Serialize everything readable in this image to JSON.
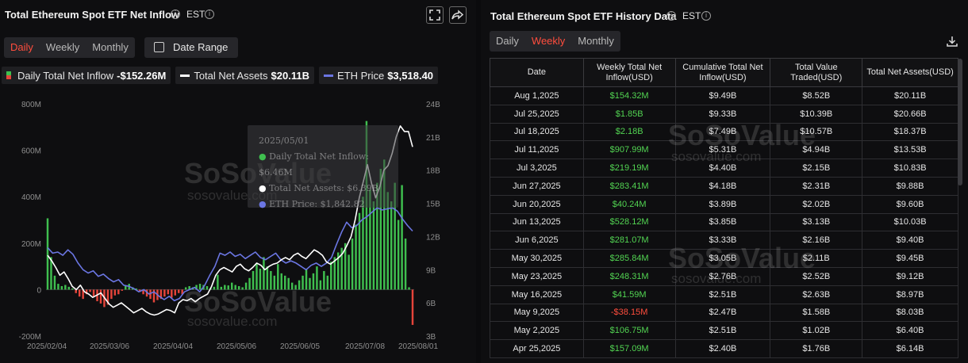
{
  "left": {
    "title": "Total Ethereum Spot ETF Net Inflow",
    "timezone": "EST",
    "tabs": [
      "Daily",
      "Weekly",
      "Monthly"
    ],
    "active_tab": "Daily",
    "date_range_label": "Date Range",
    "legend": {
      "inflow_label": "Daily Total Net Inflow",
      "inflow_value": "-$152.26M",
      "assets_label": "Total Net Assets",
      "assets_value": "$20.11B",
      "price_label": "ETH Price",
      "price_value": "$3,518.40"
    },
    "tooltip": {
      "date": "2025/05/01",
      "inflow": "Daily Total Net Inflow: $6.46M",
      "assets": "Total Net Assets: $6.39B",
      "price": "ETH Price: $1,842.82"
    },
    "watermark": {
      "brand": "SoSoValue",
      "site": "sosovalue.com"
    },
    "icons": {
      "fullscreen": "fullscreen-icon",
      "share": "share-icon",
      "calendar": "calendar-icon",
      "download": "download-icon"
    }
  },
  "chart_data": {
    "type": "bar",
    "left_axis_ticks": [
      "800M",
      "600M",
      "400M",
      "200M",
      "0",
      "-200M"
    ],
    "right_axis_ticks": [
      "24B",
      "21B",
      "18B",
      "15B",
      "12B",
      "9B",
      "6B",
      "3B"
    ],
    "x_ticks": [
      "2025/02/04",
      "2025/03/06",
      "2025/04/04",
      "2025/05/06",
      "2025/06/05",
      "2025/07/08",
      "2025/08/01"
    ],
    "ylim_left": [
      -200,
      800
    ],
    "ylim_right": [
      3,
      24
    ],
    "inflow_values": [
      307,
      140,
      60,
      25,
      15,
      20,
      12,
      5,
      -15,
      -30,
      -40,
      -20,
      -10,
      -30,
      -50,
      -60,
      -75,
      -65,
      -40,
      -25,
      -20,
      -5,
      15,
      25,
      10,
      5,
      -10,
      -20,
      -30,
      -40,
      -55,
      -45,
      -40,
      -30,
      -20,
      -35,
      -25,
      -15,
      -20,
      10,
      15,
      10,
      20,
      25,
      20,
      15,
      6,
      12,
      64,
      12,
      20,
      18,
      30,
      20,
      15,
      10,
      30,
      50,
      80,
      110,
      90,
      140,
      100,
      80,
      60,
      110,
      70,
      60,
      50,
      30,
      20,
      40,
      60,
      90,
      50,
      70,
      100,
      40,
      80,
      60,
      120,
      140,
      160,
      180,
      200,
      150,
      220,
      280,
      330,
      400,
      726,
      430,
      380,
      460,
      520,
      560,
      420,
      380,
      460,
      300,
      450,
      220,
      10,
      -152
    ],
    "net_assets_b": [
      10.3,
      9.8,
      9.2,
      8.5,
      8.8,
      8.2,
      7.5,
      7.2,
      7.6,
      7.0,
      6.8,
      6.5,
      6.7,
      6.9,
      6.4,
      5.9,
      5.6,
      5.8,
      6.0,
      5.7,
      5.4,
      5.1,
      5.3,
      5.5,
      5.2,
      5.0,
      4.9,
      5.0,
      5.2,
      5.4,
      5.3,
      5.1,
      6.0,
      6.3,
      6.2,
      6.4,
      6.1,
      6.39,
      6.6,
      6.8,
      7.5,
      8.5,
      9.0,
      9.2,
      9.0,
      8.8,
      9.3,
      9.5,
      9.1,
      8.9,
      9.2,
      9.6,
      9.4,
      9.0,
      9.3,
      9.5,
      9.6,
      9.9,
      10.1,
      9.9,
      10.3,
      10.5,
      10.2,
      10.0,
      10.4,
      10.8,
      10.6,
      10.3,
      9.7,
      9.5,
      9.8,
      10.1,
      10.5,
      11.2,
      12.0,
      13.5,
      15.5,
      17.0,
      18.5,
      16.8,
      15.5,
      16.5,
      18.0,
      18.4,
      19.5,
      21.0,
      22.0,
      21.5,
      21.5,
      20.11
    ],
    "eth_price_b_scale": [
      11.0,
      10.5,
      10.6,
      10.3,
      10.8,
      10.4,
      9.6,
      9.0,
      8.7,
      8.9,
      8.4,
      8.6,
      8.2,
      7.9,
      8.1,
      7.6,
      7.5,
      7.3,
      7.0,
      7.2,
      6.8,
      7.0,
      6.6,
      6.3,
      6.6,
      6.2,
      6.4,
      7.0,
      7.2,
      7.4,
      7.0,
      7.6,
      8.5,
      9.3,
      10.5,
      10.3,
      10.6,
      10.2,
      10.4,
      10.0,
      10.3,
      10.6,
      10.1,
      9.9,
      10.2,
      10.5,
      9.9,
      9.6,
      9.8,
      9.6,
      9.3,
      9.0,
      9.4,
      9.6,
      9.3,
      9.6,
      10.1,
      11.3,
      12.4,
      13.3,
      12.8,
      13.0,
      13.5,
      13.8,
      14.2,
      14.6,
      14.4,
      14.5,
      14.6,
      14.3,
      13.6,
      13.0,
      12.5
    ],
    "series": [
      {
        "name": "Daily Total Net Inflow",
        "axis": "left"
      },
      {
        "name": "Total Net Assets",
        "axis": "right"
      },
      {
        "name": "ETH Price",
        "axis": "right"
      }
    ],
    "colors": {
      "positive": "#3fbf4f",
      "negative": "#e5443a",
      "assets": "#ffffff",
      "price": "#6b76e3"
    }
  },
  "right": {
    "title": "Total Ethereum Spot ETF History Data",
    "timezone": "EST",
    "tabs": [
      "Daily",
      "Weekly",
      "Monthly"
    ],
    "active_tab": "Weekly",
    "columns": [
      "Date",
      "Weekly Total Net Inflow(USD)",
      "Cumulative Total Net Inflow(USD)",
      "Total Value Traded(USD)",
      "Total Net Assets(USD)"
    ],
    "rows": [
      [
        "Aug 1,2025",
        "$154.32M",
        "$9.49B",
        "$8.52B",
        "$20.11B"
      ],
      [
        "Jul 25,2025",
        "$1.85B",
        "$9.33B",
        "$10.39B",
        "$20.66B"
      ],
      [
        "Jul 18,2025",
        "$2.18B",
        "$7.49B",
        "$10.57B",
        "$18.37B"
      ],
      [
        "Jul 11,2025",
        "$907.99M",
        "$5.31B",
        "$4.94B",
        "$13.53B"
      ],
      [
        "Jul 3,2025",
        "$219.19M",
        "$4.40B",
        "$2.15B",
        "$10.83B"
      ],
      [
        "Jun 27,2025",
        "$283.41M",
        "$4.18B",
        "$2.31B",
        "$9.88B"
      ],
      [
        "Jun 20,2025",
        "$40.24M",
        "$3.89B",
        "$2.02B",
        "$9.60B"
      ],
      [
        "Jun 13,2025",
        "$528.12M",
        "$3.85B",
        "$3.13B",
        "$10.03B"
      ],
      [
        "Jun 6,2025",
        "$281.07M",
        "$3.33B",
        "$2.16B",
        "$9.40B"
      ],
      [
        "May 30,2025",
        "$285.84M",
        "$3.05B",
        "$2.11B",
        "$9.45B"
      ],
      [
        "May 23,2025",
        "$248.31M",
        "$2.76B",
        "$2.52B",
        "$9.12B"
      ],
      [
        "May 16,2025",
        "$41.59M",
        "$2.51B",
        "$2.63B",
        "$8.97B"
      ],
      [
        "May 9,2025",
        "-$38.15M",
        "$2.47B",
        "$1.58B",
        "$8.03B"
      ],
      [
        "May 2,2025",
        "$106.75M",
        "$2.51B",
        "$1.02B",
        "$6.40B"
      ],
      [
        "Apr 25,2025",
        "$157.09M",
        "$2.40B",
        "$1.76B",
        "$6.14B"
      ]
    ]
  }
}
